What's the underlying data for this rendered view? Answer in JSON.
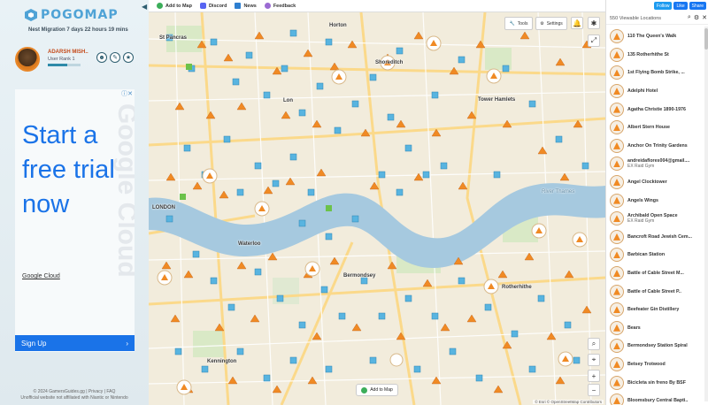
{
  "app": {
    "name": "POGOMAP"
  },
  "sidebar": {
    "nest_migration": "Nest Migration 7 days 22 hours 19 mins",
    "user": {
      "name": "ADARSH MISH..",
      "rank": "User Rank 1",
      "progress": 0.6
    },
    "ad": {
      "headline": "Start a free trial now",
      "watermark": "Google Cloud",
      "brand": "Google Cloud",
      "cta": "Sign Up"
    },
    "footer_line1": "© 2024 GamersGuides.gg  |  Privacy  |  FAQ",
    "footer_line2": "Unofficial website not affiliated with Niantic or Nintendo"
  },
  "nav": {
    "items": [
      {
        "label": "Add to Map",
        "color": "#3cae5a"
      },
      {
        "label": "Discord",
        "color": "#5865f2"
      },
      {
        "label": "News",
        "color": "#2e7fd0"
      },
      {
        "label": "Feedback",
        "color": "#9b6bd3"
      }
    ]
  },
  "map": {
    "places": [
      {
        "name": "Horton"
      },
      {
        "name": "St Pancras"
      },
      {
        "name": "Shoreditch"
      },
      {
        "name": "Lon"
      },
      {
        "name": "Tower Hamlets"
      },
      {
        "name": "LONDON"
      },
      {
        "name": "Waterloo"
      },
      {
        "name": "Bermondsey"
      },
      {
        "name": "Rotherhithe"
      },
      {
        "name": "Kennington"
      },
      {
        "name": "River Thames"
      }
    ],
    "tools_label": "Tools",
    "settings_label": "Settings",
    "add_to_map_label": "Add to Map",
    "attribution": "© Esri  © OpenStreetMap Contributors"
  },
  "panel": {
    "social": {
      "follow": "Follow",
      "like": "Like",
      "share": "Share"
    },
    "count_text": "550 Viewable Locations",
    "locations": [
      {
        "name": "110 The Queen's Walk",
        "sub": ""
      },
      {
        "name": "135 Rotherhithe St",
        "sub": ""
      },
      {
        "name": "1st Flying Bomb Strike, ...",
        "sub": ""
      },
      {
        "name": "Adelphi Hotel",
        "sub": ""
      },
      {
        "name": "Agatha Christie 1890-1976",
        "sub": ""
      },
      {
        "name": "Albert Stern House",
        "sub": ""
      },
      {
        "name": "Anchor On Trinity Gardens",
        "sub": ""
      },
      {
        "name": "andreidaflores004@gmail....",
        "sub": "EX Raid Gym"
      },
      {
        "name": "Angel Clocktower",
        "sub": ""
      },
      {
        "name": "Angels Wings",
        "sub": ""
      },
      {
        "name": "Archibald Open Space",
        "sub": "EX Raid Gym"
      },
      {
        "name": "Bancroft Road Jewish Cem...",
        "sub": ""
      },
      {
        "name": "Barbican Station",
        "sub": ""
      },
      {
        "name": "Battle of Cable Street M...",
        "sub": ""
      },
      {
        "name": "Battle of Cable Street P..",
        "sub": ""
      },
      {
        "name": "Beefeater Gin Distillery",
        "sub": ""
      },
      {
        "name": "Bears",
        "sub": ""
      },
      {
        "name": "Bermondsey Station Spiral",
        "sub": ""
      },
      {
        "name": "Betsey Trotwood",
        "sub": ""
      },
      {
        "name": "Bicicleta sin freno By BSF",
        "sub": ""
      },
      {
        "name": "Bloomsbury Central Bapti..",
        "sub": ""
      }
    ]
  }
}
